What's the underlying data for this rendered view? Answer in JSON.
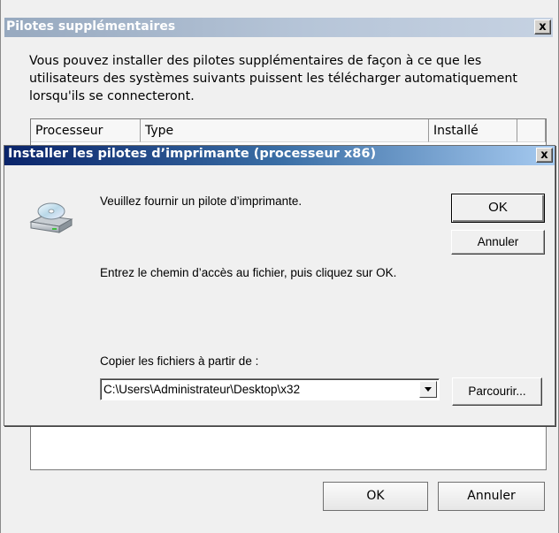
{
  "outer": {
    "title": "Pilotes supplémentaires",
    "close_label": "x",
    "description": "Vous pouvez installer des pilotes supplémentaires de façon à ce que les utilisateurs des systèmes suivants puissent les télécharger automatiquement lorsqu'ils se connecteront.",
    "columns": [
      "Processeur",
      "Type",
      "Installé",
      ""
    ],
    "ok_label": "OK",
    "cancel_label": "Annuler"
  },
  "inner": {
    "title": "Installer les pilotes d’imprimante (processeur x86)",
    "close_label": "x",
    "prompt": "Veuillez fournir un pilote d’imprimante.",
    "path_instruction": "Entrez le chemin d’accès au fichier, puis cliquez sur OK.",
    "copy_label": "Copier les fichiers à partir de :",
    "path_value": "C:\\Users\\Administrateur\\Desktop\\x32",
    "ok_label": "OK",
    "cancel_label": "Annuler",
    "browse_label": "Parcourir...",
    "icon": "disk-drive-icon"
  }
}
